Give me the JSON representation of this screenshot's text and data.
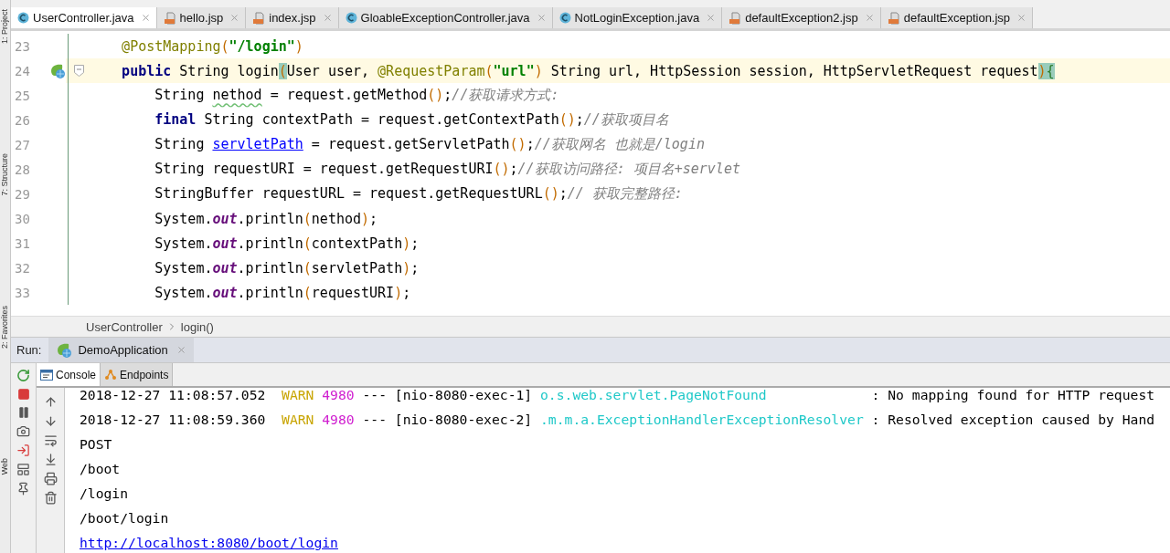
{
  "side_tools": [
    "1: Project",
    "7: Structure",
    "2: Favorites",
    "Web"
  ],
  "tabs": [
    {
      "label": "UserController.java",
      "kind": "java",
      "selected": true
    },
    {
      "label": "hello.jsp",
      "kind": "jsp",
      "selected": false
    },
    {
      "label": "index.jsp",
      "kind": "jsp",
      "selected": false
    },
    {
      "label": "GloableExceptionController.java",
      "kind": "java",
      "selected": false
    },
    {
      "label": "NotLoginException.java",
      "kind": "java",
      "selected": false
    },
    {
      "label": "defaultException2.jsp",
      "kind": "jsp",
      "selected": false
    },
    {
      "label": "defaultException.jsp",
      "kind": "jsp",
      "selected": false
    }
  ],
  "code_lines": [
    {
      "number": "23",
      "kind": "member",
      "current": false,
      "marker": false,
      "tokens": [
        {
          "kind": "ann",
          "text": "@PostMapping"
        },
        {
          "kind": "paren",
          "text": "("
        },
        {
          "kind": "str",
          "text": "\"/login\""
        },
        {
          "kind": "paren",
          "text": ")"
        }
      ]
    },
    {
      "number": "24",
      "kind": "member",
      "current": true,
      "marker": true,
      "tokens": [
        {
          "kind": "kw",
          "text": "public"
        },
        {
          "kind": "plain",
          "text": " String login"
        },
        {
          "kind": "paren-hl",
          "text": "("
        },
        {
          "kind": "plain",
          "text": "User user, "
        },
        {
          "kind": "ann",
          "text": "@RequestParam"
        },
        {
          "kind": "paren",
          "text": "("
        },
        {
          "kind": "str",
          "text": "\"url\""
        },
        {
          "kind": "paren",
          "text": ")"
        },
        {
          "kind": "plain",
          "text": " String url, HttpSession session, HttpServletRequest request"
        },
        {
          "kind": "paren-hl",
          "text": ")"
        },
        {
          "kind": "brace-hl",
          "text": "{"
        }
      ]
    },
    {
      "number": "25",
      "kind": "statement",
      "current": false,
      "marker": false,
      "tokens": [
        {
          "kind": "plain",
          "text": "String "
        },
        {
          "kind": "warn",
          "text": "nethod"
        },
        {
          "kind": "plain",
          "text": " = request.getMethod"
        },
        {
          "kind": "paren",
          "text": "()"
        },
        {
          "kind": "plain",
          "text": ";"
        },
        {
          "kind": "cmt",
          "text": "//获取请求方式:"
        }
      ]
    },
    {
      "number": "26",
      "kind": "statement",
      "current": false,
      "marker": false,
      "tokens": [
        {
          "kind": "kw",
          "text": "final"
        },
        {
          "kind": "plain",
          "text": " String contextPath = request.getContextPath"
        },
        {
          "kind": "paren",
          "text": "()"
        },
        {
          "kind": "plain",
          "text": ";"
        },
        {
          "kind": "cmt",
          "text": "//获取项目名"
        }
      ]
    },
    {
      "number": "27",
      "kind": "statement",
      "current": false,
      "marker": false,
      "tokens": [
        {
          "kind": "plain",
          "text": "String "
        },
        {
          "kind": "link",
          "text": "servletPath"
        },
        {
          "kind": "plain",
          "text": " = request.getServletPath"
        },
        {
          "kind": "paren",
          "text": "()"
        },
        {
          "kind": "plain",
          "text": ";"
        },
        {
          "kind": "cmt",
          "text": "//获取网名 也就是/login"
        }
      ]
    },
    {
      "number": "28",
      "kind": "statement",
      "current": false,
      "marker": false,
      "tokens": [
        {
          "kind": "plain",
          "text": "String requestURI = request.getRequestURI"
        },
        {
          "kind": "paren",
          "text": "()"
        },
        {
          "kind": "plain",
          "text": ";"
        },
        {
          "kind": "cmt",
          "text": "//获取访问路径: 项目名+servlet"
        }
      ]
    },
    {
      "number": "29",
      "kind": "statement",
      "current": false,
      "marker": false,
      "tokens": [
        {
          "kind": "plain",
          "text": "StringBuffer requestURL = request.getRequestURL"
        },
        {
          "kind": "paren",
          "text": "()"
        },
        {
          "kind": "plain",
          "text": ";"
        },
        {
          "kind": "cmt",
          "text": "// 获取完整路径:"
        }
      ]
    },
    {
      "number": "30",
      "kind": "statement",
      "current": false,
      "marker": false,
      "tokens": [
        {
          "kind": "plain",
          "text": "System."
        },
        {
          "kind": "static",
          "text": "out"
        },
        {
          "kind": "plain",
          "text": ".println"
        },
        {
          "kind": "paren",
          "text": "("
        },
        {
          "kind": "plain",
          "text": "nethod"
        },
        {
          "kind": "paren",
          "text": ")"
        },
        {
          "kind": "plain",
          "text": ";"
        }
      ]
    },
    {
      "number": "31",
      "kind": "statement",
      "current": false,
      "marker": false,
      "tokens": [
        {
          "kind": "plain",
          "text": "System."
        },
        {
          "kind": "static",
          "text": "out"
        },
        {
          "kind": "plain",
          "text": ".println"
        },
        {
          "kind": "paren",
          "text": "("
        },
        {
          "kind": "plain",
          "text": "contextPath"
        },
        {
          "kind": "paren",
          "text": ")"
        },
        {
          "kind": "plain",
          "text": ";"
        }
      ]
    },
    {
      "number": "32",
      "kind": "statement",
      "current": false,
      "marker": false,
      "tokens": [
        {
          "kind": "plain",
          "text": "System."
        },
        {
          "kind": "static",
          "text": "out"
        },
        {
          "kind": "plain",
          "text": ".println"
        },
        {
          "kind": "paren",
          "text": "("
        },
        {
          "kind": "plain",
          "text": "servletPath"
        },
        {
          "kind": "paren",
          "text": ")"
        },
        {
          "kind": "plain",
          "text": ";"
        }
      ]
    },
    {
      "number": "33",
      "kind": "statement",
      "current": false,
      "marker": false,
      "tokens": [
        {
          "kind": "plain",
          "text": "System."
        },
        {
          "kind": "static",
          "text": "out"
        },
        {
          "kind": "plain",
          "text": ".println"
        },
        {
          "kind": "paren",
          "text": "("
        },
        {
          "kind": "plain",
          "text": "requestURI"
        },
        {
          "kind": "paren",
          "text": ")"
        },
        {
          "kind": "plain",
          "text": ";"
        }
      ]
    }
  ],
  "breadcrumb": [
    "UserController",
    "login()"
  ],
  "run": {
    "label": "Run:",
    "config": "DemoApplication"
  },
  "console_tabs": [
    {
      "label": "Console",
      "kind": "console",
      "selected": true
    },
    {
      "label": "Endpoints",
      "kind": "endpoints",
      "selected": false
    }
  ],
  "console_lines": [
    {
      "kind": "log",
      "time": "2018-12-27 11:08:57.052",
      "severity": "WARN",
      "pid": "4980",
      "thread": "--- [nio-8080-exec-1]",
      "logger": "o.s.web.servlet.PageNotFound",
      "message": ": No mapping found for HTTP request"
    },
    {
      "kind": "log",
      "time": "2018-12-27 11:08:59.360",
      "severity": "WARN",
      "pid": "4980",
      "thread": "--- [nio-8080-exec-2]",
      "logger": ".m.m.a.ExceptionHandlerExceptionResolver",
      "message": ": Resolved exception caused by Hand"
    },
    {
      "kind": "out",
      "text": "POST"
    },
    {
      "kind": "out",
      "text": "/boot"
    },
    {
      "kind": "out",
      "text": "/login"
    },
    {
      "kind": "out",
      "text": "/boot/login"
    },
    {
      "kind": "link",
      "text": "http://localhost:8080/boot/login"
    }
  ]
}
